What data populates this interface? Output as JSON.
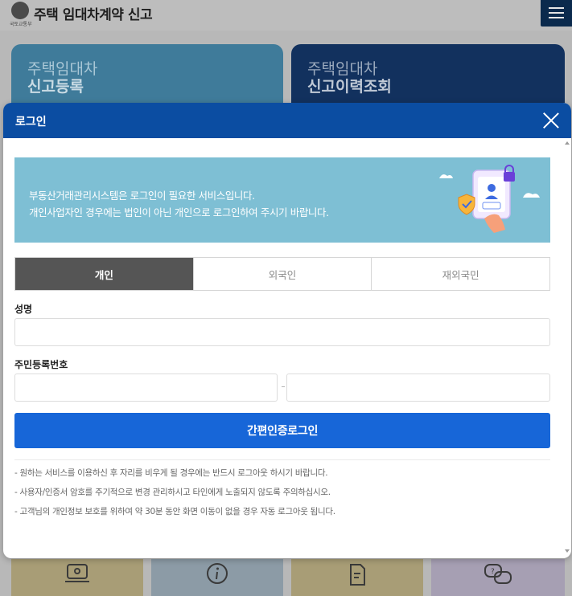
{
  "background": {
    "logo_sub": "국토교통부",
    "site_title": "주택 임대차계약 신고",
    "cards": [
      {
        "line1": "주택임대차",
        "line2": "신고등록"
      },
      {
        "line1": "주택임대차",
        "line2": "신고이력조회"
      }
    ]
  },
  "modal": {
    "title": "로그인",
    "banner": {
      "line1": "부동산거래관리시스템은 로그인이 필요한 서비스입니다.",
      "line2": "개인사업자인 경우에는 법인이 아닌 개인으로 로그인하여 주시기 바랍니다."
    },
    "tabs": [
      {
        "label": "개인",
        "active": true
      },
      {
        "label": "외국인",
        "active": false
      },
      {
        "label": "재외국민",
        "active": false
      }
    ],
    "name_label": "성명",
    "name_value": "",
    "rrn_label": "주민등록번호",
    "rrn_front_value": "",
    "rrn_back_value": "",
    "login_button": "간편인증로그인",
    "notes": [
      "- 원하는 서비스를 이용하신 후 자리를 비우게 될 경우에는 반드시 로그아웃 하시기 바랍니다.",
      "- 사용자/인증서 암호를 주기적으로 변경 관리하시고 타인에게 노출되지 않도록 주의하십시오.",
      "- 고객님의 개인정보 보호를 위하여 약 30분 동안 화면 이동이 없을 경우 자동 로그아웃 됩니다."
    ]
  },
  "colors": {
    "header_blue": "#0b4da2",
    "button_blue": "#1766d8",
    "banner_bg": "#7ebfd4",
    "active_tab": "#555555"
  },
  "icons": [
    "close-icon",
    "menu-icon",
    "lock-icon",
    "shield-check-icon",
    "monitor-icon",
    "info-icon",
    "document-icon",
    "question-chat-icon"
  ]
}
